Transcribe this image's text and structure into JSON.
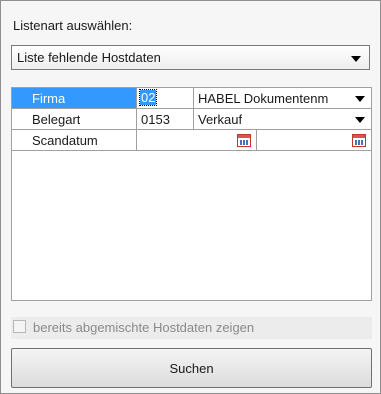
{
  "panel": {
    "list_type_label": "Listenart auswählen:",
    "list_type_value": "Liste fehlende Hostdaten"
  },
  "grid": {
    "rows": [
      {
        "label": "Firma",
        "code": "02",
        "value": "HABEL Dokumentenm"
      },
      {
        "label": "Belegart",
        "code": "0153",
        "value": "Verkauf"
      },
      {
        "label": "Scandatum",
        "from": "",
        "to": ""
      }
    ]
  },
  "checkbox": {
    "label": "bereits abgemischte Hostdaten zeigen",
    "checked": false
  },
  "search_button": {
    "label": "Suchen"
  },
  "colors": {
    "selection": "#3399ff",
    "calendar_red": "#d9534f"
  }
}
